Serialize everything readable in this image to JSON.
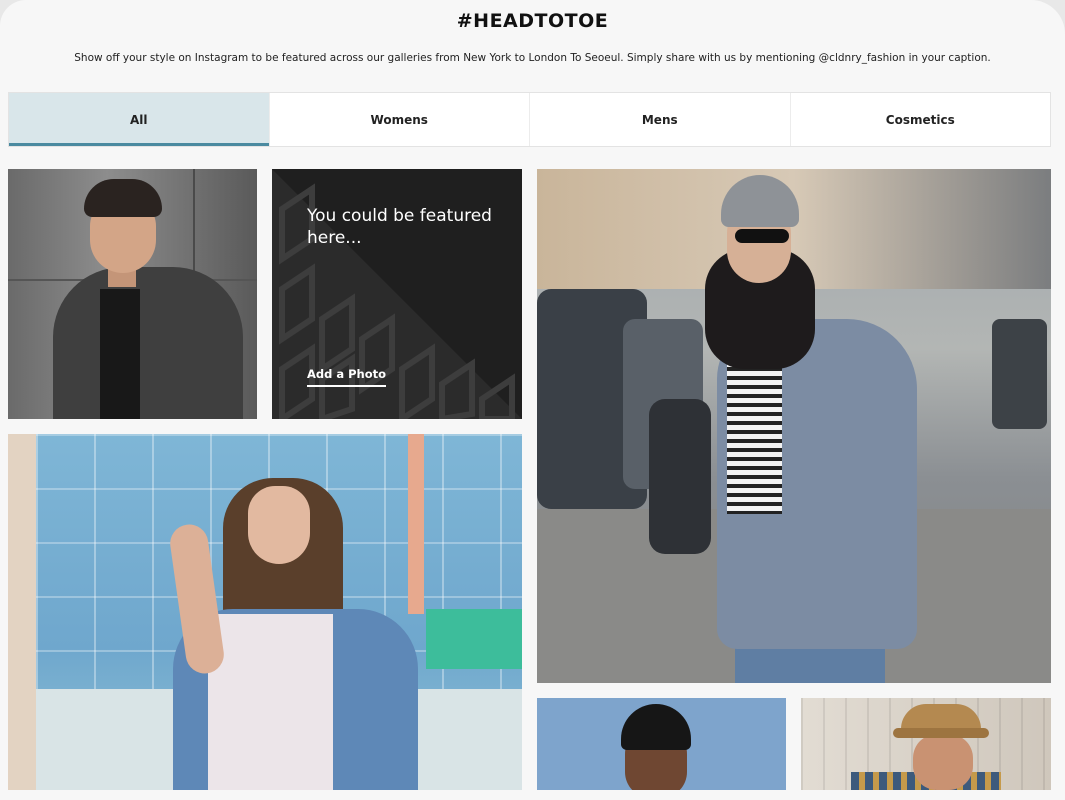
{
  "header": {
    "title": "#HEADTOTOE",
    "subtitle": "Show off your style on Instagram to be featured across our galleries from New York to London To Seoeul. Simply share with us by mentioning @cldnry_fashion in your caption."
  },
  "tabs": [
    {
      "label": "All",
      "active": true
    },
    {
      "label": "Womens",
      "active": false
    },
    {
      "label": "Mens",
      "active": false
    },
    {
      "label": "Cosmetics",
      "active": false
    }
  ],
  "feature_card": {
    "text": "You could be featured here...",
    "link": "Add a Photo"
  },
  "colors": {
    "active_tab_bg": "#d9e6ea",
    "active_tab_underline": "#4a8aa0",
    "feature_bg": "#1f1f1f"
  }
}
